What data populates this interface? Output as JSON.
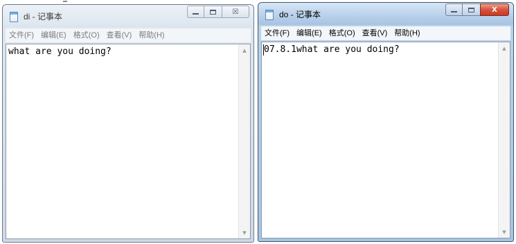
{
  "windows": [
    {
      "id": "left",
      "state": "inactive",
      "title": "di - 记事本",
      "menu": [
        "文件(F)",
        "编辑(E)",
        "格式(O)",
        "查看(V)",
        "帮助(H)"
      ],
      "content": "what are you doing?",
      "caption_buttons": {
        "close": "☒"
      }
    },
    {
      "id": "right",
      "state": "active",
      "title": "do - 记事本",
      "menu": [
        "文件(F)",
        "编辑(E)",
        "格式(O)",
        "查看(V)",
        "帮助(H)"
      ],
      "content": "07.8.1what are you doing?",
      "caption_buttons": {
        "close": "X"
      }
    }
  ],
  "scrollbar": {
    "up": "▲",
    "down": "▼"
  },
  "icons": {
    "app": "notepad-icon",
    "minimize": "minimize-icon",
    "maximize": "maximize-icon",
    "close": "close-icon"
  },
  "colors": {
    "active_title": "#b8d0ea",
    "inactive_title": "#dce5ee",
    "close_active": "#d8533b"
  }
}
